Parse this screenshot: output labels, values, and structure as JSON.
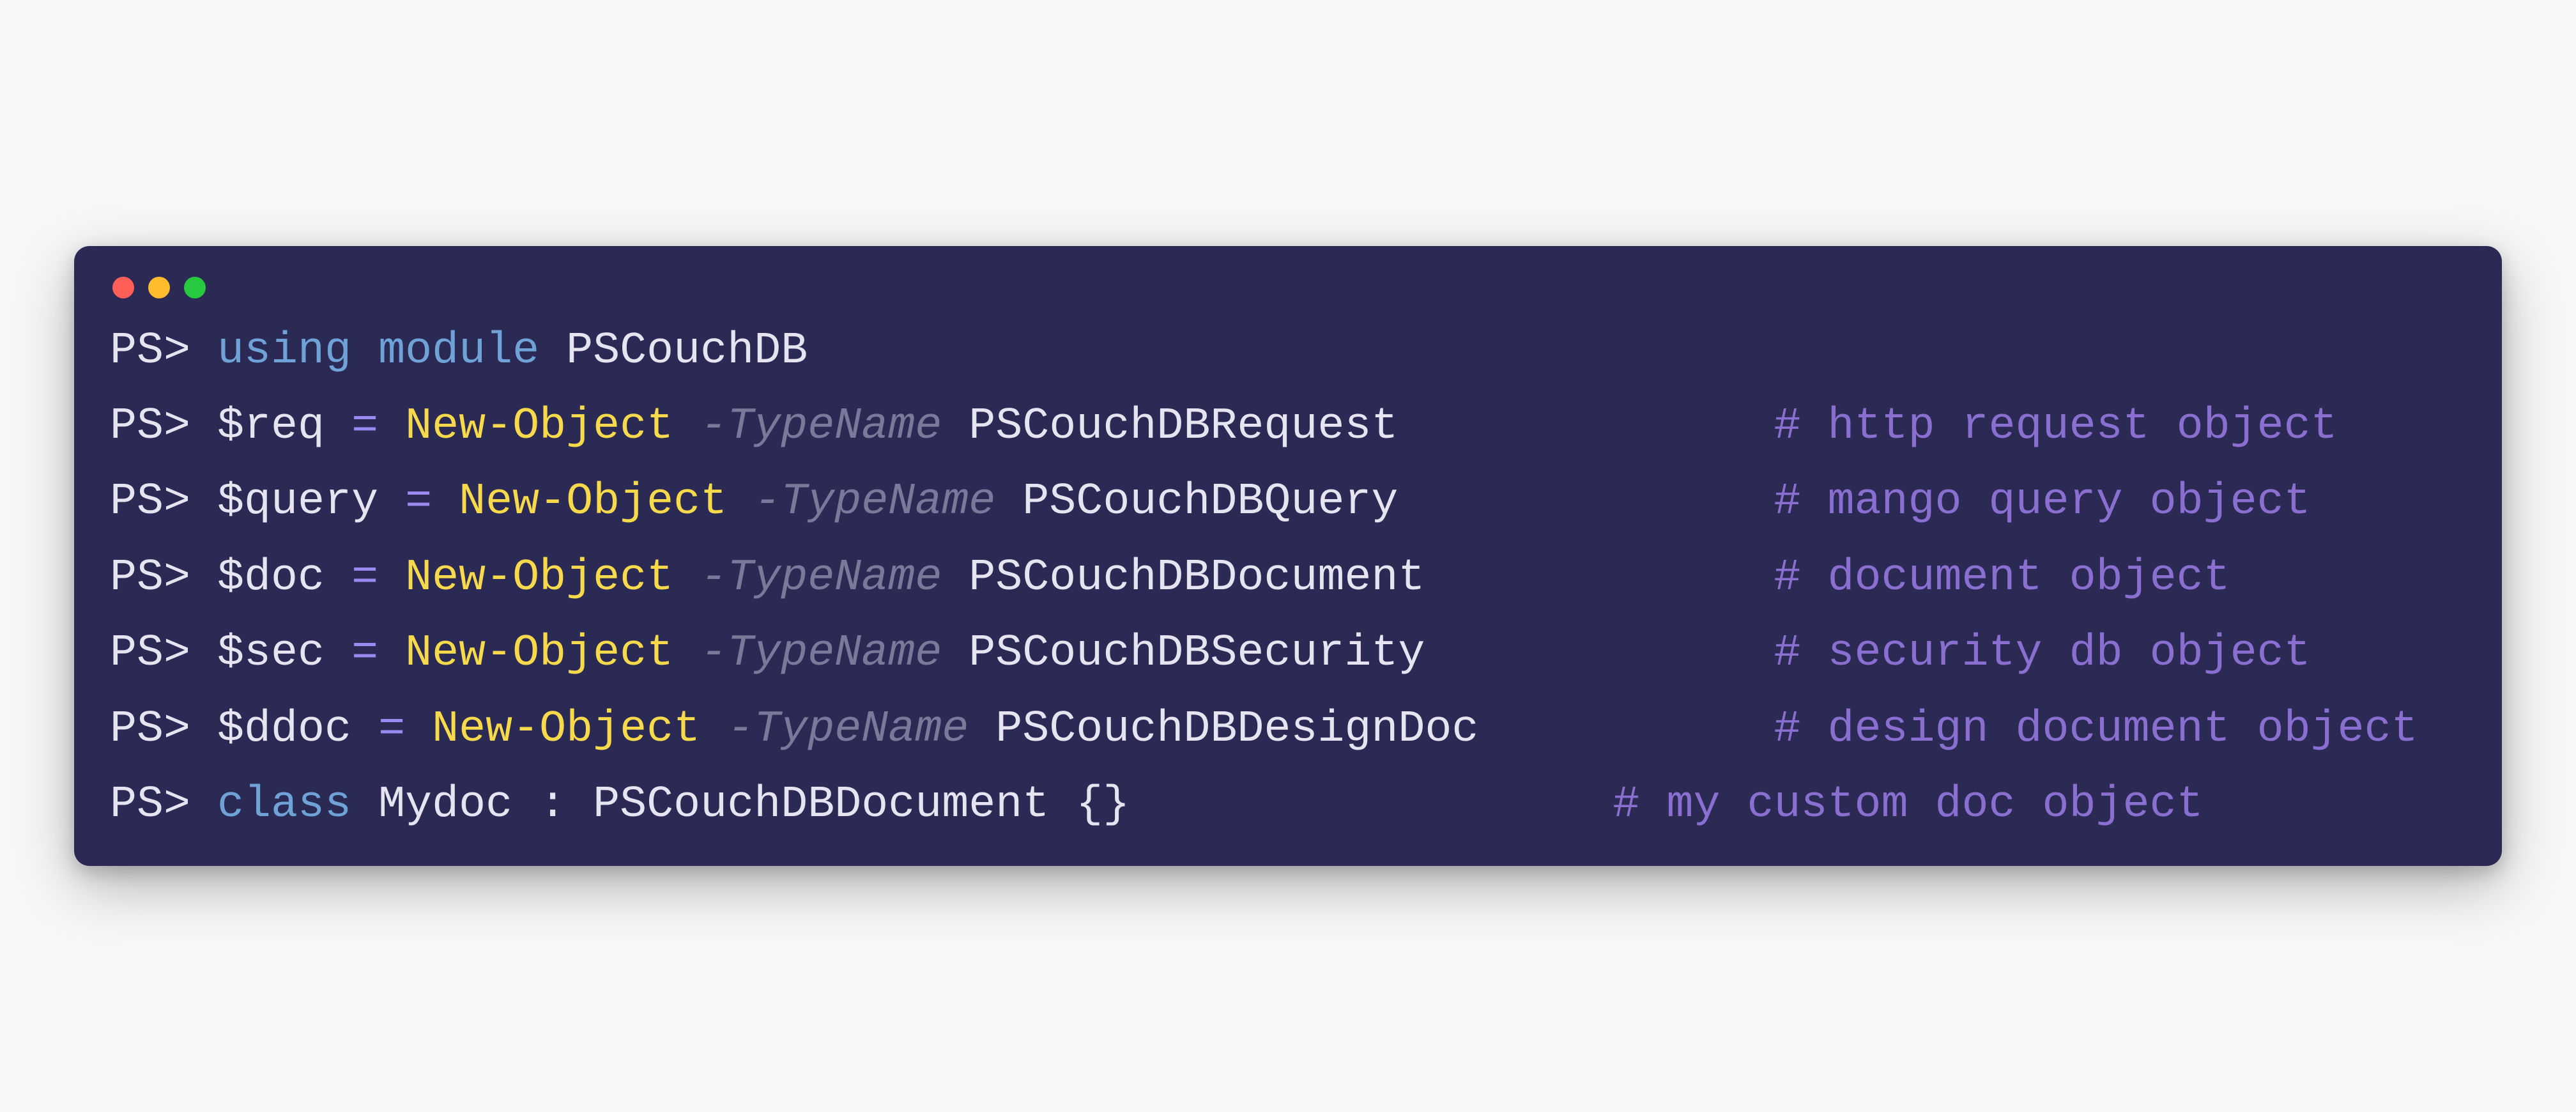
{
  "titlebar": {
    "buttons": [
      "close",
      "minimize",
      "zoom"
    ]
  },
  "prompt": "PS>",
  "colors": {
    "background": "#2b2a55",
    "keyword": "#6fa3d8",
    "cmdlet": "#f7d94c",
    "param": "#7b7899",
    "comment": "#8a6fd1",
    "operator": "#9a8af1",
    "text": "#e6e4f0"
  },
  "lines": [
    {
      "tokens": [
        {
          "cls": "prompt",
          "t": "PS> "
        },
        {
          "cls": "keyword",
          "t": "using"
        },
        {
          "cls": "module",
          "t": " "
        },
        {
          "cls": "keyword",
          "t": "module"
        },
        {
          "cls": "module",
          "t": " PSCouchDB"
        }
      ]
    },
    {
      "tokens": [
        {
          "cls": "prompt",
          "t": "PS> "
        },
        {
          "cls": "var",
          "t": "$req "
        },
        {
          "cls": "assign",
          "t": "="
        },
        {
          "cls": "var",
          "t": " "
        },
        {
          "cls": "cmdlet",
          "t": "New-Object"
        },
        {
          "cls": "var",
          "t": " "
        },
        {
          "cls": "param",
          "t": "-TypeName"
        },
        {
          "cls": "var",
          "t": " "
        },
        {
          "cls": "type",
          "t": "PSCouchDBRequest              "
        },
        {
          "cls": "comment",
          "t": "# http request object"
        }
      ]
    },
    {
      "tokens": [
        {
          "cls": "prompt",
          "t": "PS> "
        },
        {
          "cls": "var",
          "t": "$query "
        },
        {
          "cls": "assign",
          "t": "="
        },
        {
          "cls": "var",
          "t": " "
        },
        {
          "cls": "cmdlet",
          "t": "New-Object"
        },
        {
          "cls": "var",
          "t": " "
        },
        {
          "cls": "param",
          "t": "-TypeName"
        },
        {
          "cls": "var",
          "t": " "
        },
        {
          "cls": "type",
          "t": "PSCouchDBQuery              "
        },
        {
          "cls": "comment",
          "t": "# mango query object"
        }
      ]
    },
    {
      "tokens": [
        {
          "cls": "prompt",
          "t": "PS> "
        },
        {
          "cls": "var",
          "t": "$doc "
        },
        {
          "cls": "assign",
          "t": "="
        },
        {
          "cls": "var",
          "t": " "
        },
        {
          "cls": "cmdlet",
          "t": "New-Object"
        },
        {
          "cls": "var",
          "t": " "
        },
        {
          "cls": "param",
          "t": "-TypeName"
        },
        {
          "cls": "var",
          "t": " "
        },
        {
          "cls": "type",
          "t": "PSCouchDBDocument             "
        },
        {
          "cls": "comment",
          "t": "# document object"
        }
      ]
    },
    {
      "tokens": [
        {
          "cls": "prompt",
          "t": "PS> "
        },
        {
          "cls": "var",
          "t": "$sec "
        },
        {
          "cls": "assign",
          "t": "="
        },
        {
          "cls": "var",
          "t": " "
        },
        {
          "cls": "cmdlet",
          "t": "New-Object"
        },
        {
          "cls": "var",
          "t": " "
        },
        {
          "cls": "param",
          "t": "-TypeName"
        },
        {
          "cls": "var",
          "t": " "
        },
        {
          "cls": "type",
          "t": "PSCouchDBSecurity             "
        },
        {
          "cls": "comment",
          "t": "# security db object"
        }
      ]
    },
    {
      "tokens": [
        {
          "cls": "prompt",
          "t": "PS> "
        },
        {
          "cls": "var",
          "t": "$ddoc "
        },
        {
          "cls": "assign",
          "t": "="
        },
        {
          "cls": "var",
          "t": " "
        },
        {
          "cls": "cmdlet",
          "t": "New-Object"
        },
        {
          "cls": "var",
          "t": " "
        },
        {
          "cls": "param",
          "t": "-TypeName"
        },
        {
          "cls": "var",
          "t": " "
        },
        {
          "cls": "type",
          "t": "PSCouchDBDesignDoc           "
        },
        {
          "cls": "comment",
          "t": "# design document object"
        }
      ]
    },
    {
      "tokens": [
        {
          "cls": "prompt",
          "t": "PS> "
        },
        {
          "cls": "classkw",
          "t": "class"
        },
        {
          "cls": "classname",
          "t": " Mydoc "
        },
        {
          "cls": "punct",
          "t": ": "
        },
        {
          "cls": "type",
          "t": "PSCouchDBDocument "
        },
        {
          "cls": "punct",
          "t": "{}                  "
        },
        {
          "cls": "comment",
          "t": "# my custom doc object"
        }
      ]
    }
  ]
}
